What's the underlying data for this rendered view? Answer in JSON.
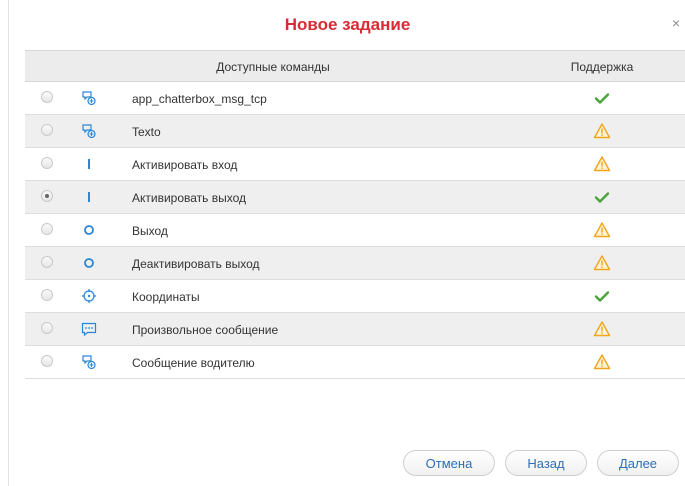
{
  "dialog": {
    "title": "Новое задание",
    "close_label": "×"
  },
  "table": {
    "col_commands": "Доступные команды",
    "col_support": "Поддержка",
    "rows": [
      {
        "label": "app_chatterbox_msg_tcp",
        "icon": "message-bubbles-icon",
        "support": "ok",
        "selected": false
      },
      {
        "label": "Texto",
        "icon": "message-bubbles-icon",
        "support": "warning",
        "selected": false
      },
      {
        "label": "Активировать вход",
        "icon": "input-bar-icon",
        "support": "warning",
        "selected": false
      },
      {
        "label": "Активировать выход",
        "icon": "input-bar-icon",
        "support": "ok",
        "selected": true
      },
      {
        "label": "Выход",
        "icon": "output-circle-icon",
        "support": "warning",
        "selected": false
      },
      {
        "label": "Деактивировать выход",
        "icon": "output-circle-icon",
        "support": "warning",
        "selected": false
      },
      {
        "label": "Координаты",
        "icon": "crosshair-icon",
        "support": "ok",
        "selected": false
      },
      {
        "label": "Произвольное сообщение",
        "icon": "chat-dots-icon",
        "support": "warning",
        "selected": false
      },
      {
        "label": "Сообщение водителю",
        "icon": "message-bubbles-icon",
        "support": "warning",
        "selected": false
      }
    ]
  },
  "buttons": {
    "cancel": "Отмена",
    "back": "Назад",
    "next": "Далее"
  },
  "colors": {
    "title": "#d72c36",
    "icon_blue": "#2b86d6",
    "ok_green": "#4ba33b",
    "warning_orange": "#f0a51b"
  }
}
